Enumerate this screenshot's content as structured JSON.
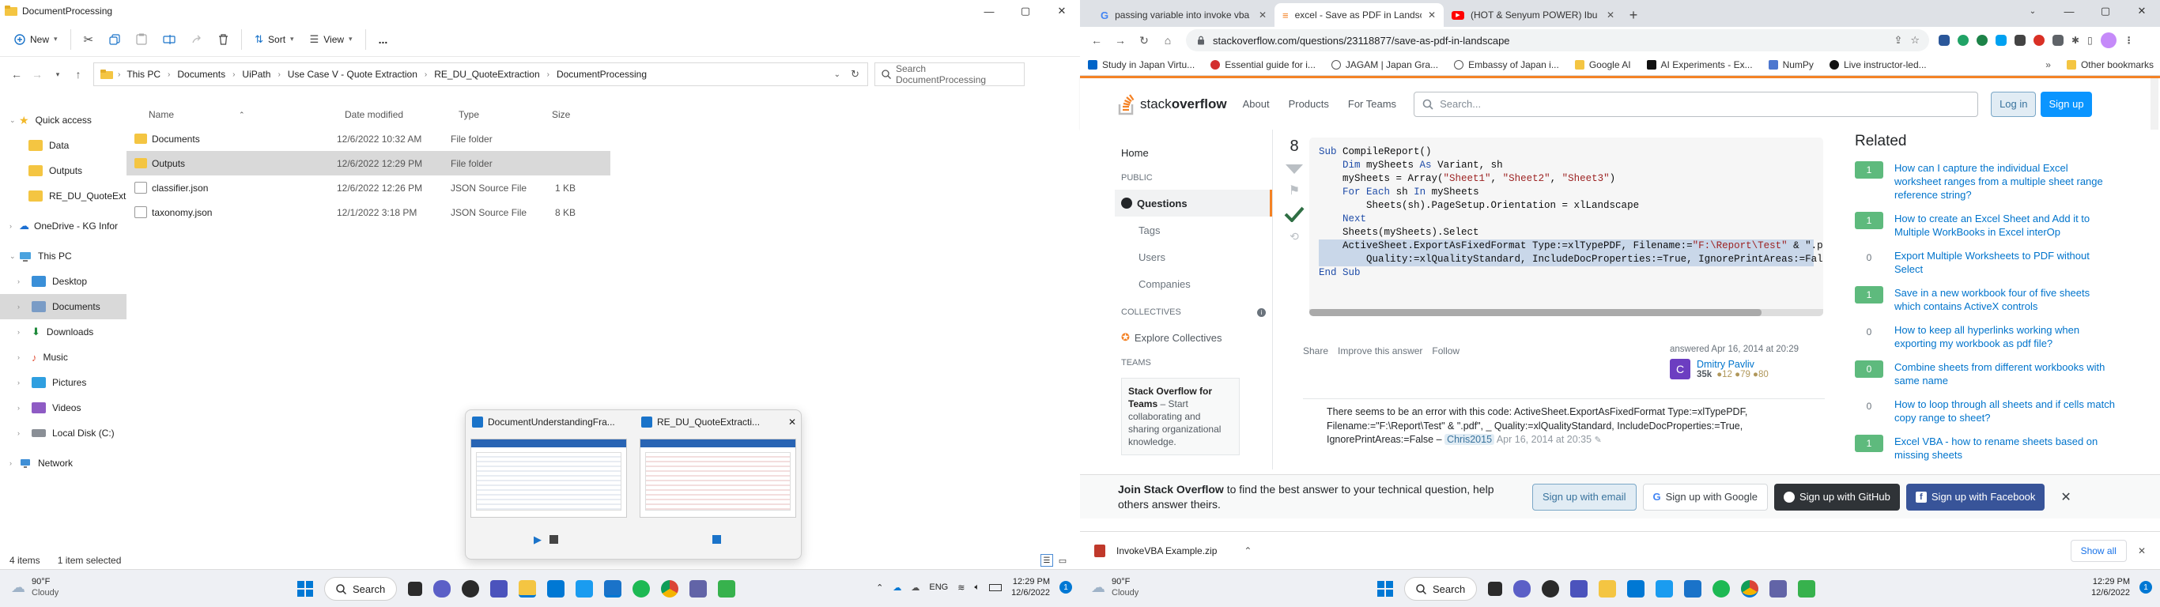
{
  "explorer": {
    "window_title": "DocumentProcessing",
    "toolbar": {
      "new": "New",
      "sort": "Sort",
      "view": "View",
      "more": "..."
    },
    "breadcrumb": [
      "This PC",
      "Documents",
      "UiPath",
      "Use Case V - Quote Extraction",
      "RE_DU_QuoteExtraction",
      "DocumentProcessing"
    ],
    "search_placeholder": "Search DocumentProcessing",
    "nav": {
      "quick_access": "Quick access",
      "quick_items": [
        "Data",
        "Outputs",
        "RE_DU_QuoteExtra"
      ],
      "onedrive": "OneDrive - KG Infor",
      "this_pc": "This PC",
      "pc_items": [
        "Desktop",
        "Documents",
        "Downloads",
        "Music",
        "Pictures",
        "Videos",
        "Local Disk (C:)"
      ],
      "network": "Network"
    },
    "columns": {
      "name": "Name",
      "date": "Date modified",
      "type": "Type",
      "size": "Size"
    },
    "files": [
      {
        "name": "Documents",
        "date": "12/6/2022 10:32 AM",
        "type": "File folder",
        "size": ""
      },
      {
        "name": "Outputs",
        "date": "12/6/2022 12:29 PM",
        "type": "File folder",
        "size": ""
      },
      {
        "name": "classifier.json",
        "date": "12/6/2022 12:26 PM",
        "type": "JSON Source File",
        "size": "1 KB"
      },
      {
        "name": "taxonomy.json",
        "date": "12/1/2022 3:18 PM",
        "type": "JSON Source File",
        "size": "8 KB"
      }
    ],
    "status": {
      "count": "4 items",
      "selected": "1 item selected"
    }
  },
  "thumbs": {
    "title1": "DocumentUnderstandingFra...",
    "title2": "RE_DU_QuoteExtracti..."
  },
  "chrome": {
    "tabs": [
      {
        "title": "passing variable into invoke vba",
        "icon": "google-icon"
      },
      {
        "title": "excel - Save as PDF in Landscape",
        "icon": "stackoverflow-icon"
      },
      {
        "title": "(HOT & Senyum POWER) Ibu Bap",
        "icon": "youtube-icon"
      }
    ],
    "url": "stackoverflow.com/questions/23118877/save-as-pdf-in-landscape",
    "bookmarks": [
      "Study in Japan Virtu...",
      "Essential guide for i...",
      "JAGAM | Japan Gra...",
      "Embassy of Japan i...",
      "Google AI",
      "AI Experiments - Ex...",
      "NumPy",
      "Live instructor-led..."
    ],
    "other_bookmarks": "Other bookmarks"
  },
  "so": {
    "nav": {
      "about": "About",
      "products": "Products",
      "for_teams": "For Teams"
    },
    "search_placeholder": "Search...",
    "login": "Log in",
    "signup": "Sign up",
    "left": {
      "home": "Home",
      "public": "PUBLIC",
      "questions": "Questions",
      "tags": "Tags",
      "users": "Users",
      "companies": "Companies",
      "collectives": "COLLECTIVES",
      "explore": "Explore Collectives",
      "teams": "TEAMS",
      "teams_title": "Stack Overflow for Teams",
      "teams_desc": "– Start collaborating and sharing organizational knowledge."
    },
    "vote_count": "8",
    "code_lines": [
      "Sub CompileReport()",
      "    Dim mySheets As Variant, sh",
      "",
      "    mySheets = Array(\"Sheet1\", \"Sheet2\", \"Sheet3\")",
      "    For Each sh In mySheets",
      "        Sheets(sh).PageSetup.Orientation = xlLandscape",
      "    Next",
      "",
      "    Sheets(mySheets).Select",
      "    ActiveSheet.ExportAsFixedFormat Type:=xlTypePDF, Filename:=\"F:\\Report\\Test\" & \".p",
      "        Quality:=xlQualityStandard, IncludeDocProperties:=True, IgnorePrintAreas:=Fal",
      "End Sub"
    ],
    "answer_actions": [
      "Share",
      "Improve this answer",
      "Follow"
    ],
    "answered": "answered Apr 16, 2014 at 20:29",
    "author": "Dmitry Pavliv",
    "author_rep": "35k",
    "badges": "●12  ●79  ●80",
    "comment": "There seems to be an error with this code: ActiveSheet.ExportAsFixedFormat Type:=xlTypePDF, Filename:=\"F:\\Report\\Test\" & \".pdf\", _ Quality:=xlQualityStandard, IncludeDocProperties:=True, IgnorePrintAreas:=False –",
    "comment_user": "Chris2015",
    "comment_date": "Apr 16, 2014 at 20:35",
    "related_title": "Related",
    "related": [
      {
        "score": "1",
        "accepted": true,
        "title": "How can I capture the individual Excel worksheet ranges from a multiple sheet range reference string?"
      },
      {
        "score": "1",
        "accepted": true,
        "title": "How to create an Excel Sheet and Add it to Multiple WorkBooks in Excel interOp"
      },
      {
        "score": "0",
        "accepted": false,
        "title": "Export Multiple Worksheets to PDF without Select"
      },
      {
        "score": "1",
        "accepted": true,
        "title": "Save in a new workbook four of five sheets which contains ActiveX controls"
      },
      {
        "score": "0",
        "accepted": false,
        "title": "How to keep all hyperlinks working when exporting my workbook as pdf file?"
      },
      {
        "score": "0",
        "accepted": true,
        "title": "Combine sheets from different workbooks with same name"
      },
      {
        "score": "0",
        "accepted": false,
        "title": "How to loop through all sheets and if cells match copy range to sheet?"
      },
      {
        "score": "1",
        "accepted": true,
        "title": "Excel VBA - how to rename sheets based on missing sheets"
      }
    ],
    "join_bold": "Join Stack Overflow",
    "join_text": " to find the best answer to your technical question, help others answer theirs.",
    "signup_email": "Sign up with email",
    "signup_google": "Sign up with Google",
    "signup_github": "Sign up with GitHub",
    "signup_facebook": "Sign up with Facebook"
  },
  "download": {
    "file": "InvokeVBA Example.zip",
    "show_all": "Show all"
  },
  "taskbar": {
    "weather_temp": "90°F",
    "weather_desc": "Cloudy",
    "search": "Search",
    "lang": "ENG",
    "time": "12:29 PM",
    "date": "12/6/2022",
    "notif": "1"
  },
  "colors": {
    "so_orange": "#f48225",
    "so_blue": "#0a95ff",
    "accepted_green": "#5eba7d",
    "link_blue": "#0074cc"
  }
}
